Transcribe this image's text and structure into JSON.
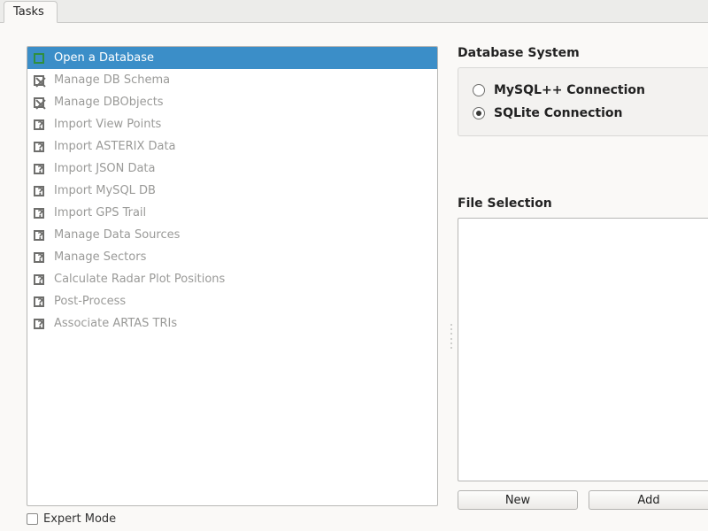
{
  "tab": {
    "label": "Tasks"
  },
  "tasks": [
    {
      "label": "Open a Database",
      "icon": "open",
      "selected": true
    },
    {
      "label": "Manage DB Schema",
      "icon": "x",
      "selected": false
    },
    {
      "label": "Manage DBObjects",
      "icon": "x",
      "selected": false
    },
    {
      "label": "Import View Points",
      "icon": "q",
      "selected": false
    },
    {
      "label": "Import ASTERIX Data",
      "icon": "q",
      "selected": false
    },
    {
      "label": "Import JSON Data",
      "icon": "q",
      "selected": false
    },
    {
      "label": "Import MySQL DB",
      "icon": "q",
      "selected": false
    },
    {
      "label": "Import GPS Trail",
      "icon": "q",
      "selected": false
    },
    {
      "label": "Manage Data Sources",
      "icon": "q",
      "selected": false
    },
    {
      "label": "Manage Sectors",
      "icon": "q",
      "selected": false
    },
    {
      "label": "Calculate Radar Plot Positions",
      "icon": "q",
      "selected": false
    },
    {
      "label": "Post-Process",
      "icon": "q",
      "selected": false
    },
    {
      "label": "Associate ARTAS TRIs",
      "icon": "q",
      "selected": false
    }
  ],
  "right": {
    "db_system_label": "Database System",
    "radios": [
      {
        "label": "MySQL++ Connection",
        "checked": false
      },
      {
        "label": "SQLite Connection",
        "checked": true
      }
    ],
    "file_selection_label": "File Selection",
    "buttons": {
      "new": "New",
      "add": "Add"
    }
  },
  "footer": {
    "expert_mode_label": "Expert Mode",
    "expert_mode_checked": false
  }
}
